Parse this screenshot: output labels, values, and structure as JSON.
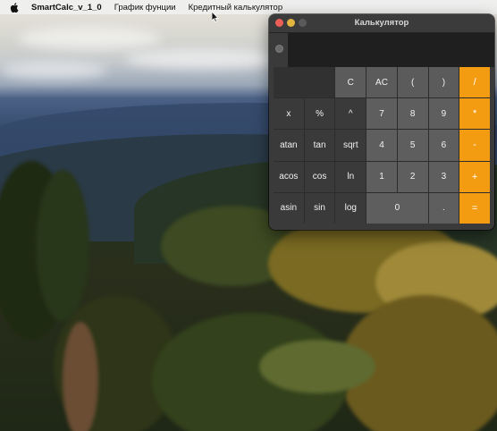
{
  "menubar": {
    "app_name": "SmartCalc_v_1_0",
    "items": [
      "График фунции",
      "Кредитный калькулятор"
    ]
  },
  "window": {
    "title": "Калькулятор",
    "display_value": ""
  },
  "keys": [
    "C",
    "AC",
    "(",
    ")",
    "/",
    "x",
    "%",
    "^",
    "7",
    "8",
    "9",
    "*",
    "atan",
    "tan",
    "sqrt",
    "4",
    "5",
    "6",
    "-",
    "acos",
    "cos",
    "ln",
    "1",
    "2",
    "3",
    "+",
    "asin",
    "sin",
    "log",
    "0",
    ".",
    "="
  ],
  "colors": {
    "operator": "#f39c12",
    "window_bg": "#3a3a3a",
    "close": "#ec5f57",
    "minimize": "#e3b540"
  }
}
